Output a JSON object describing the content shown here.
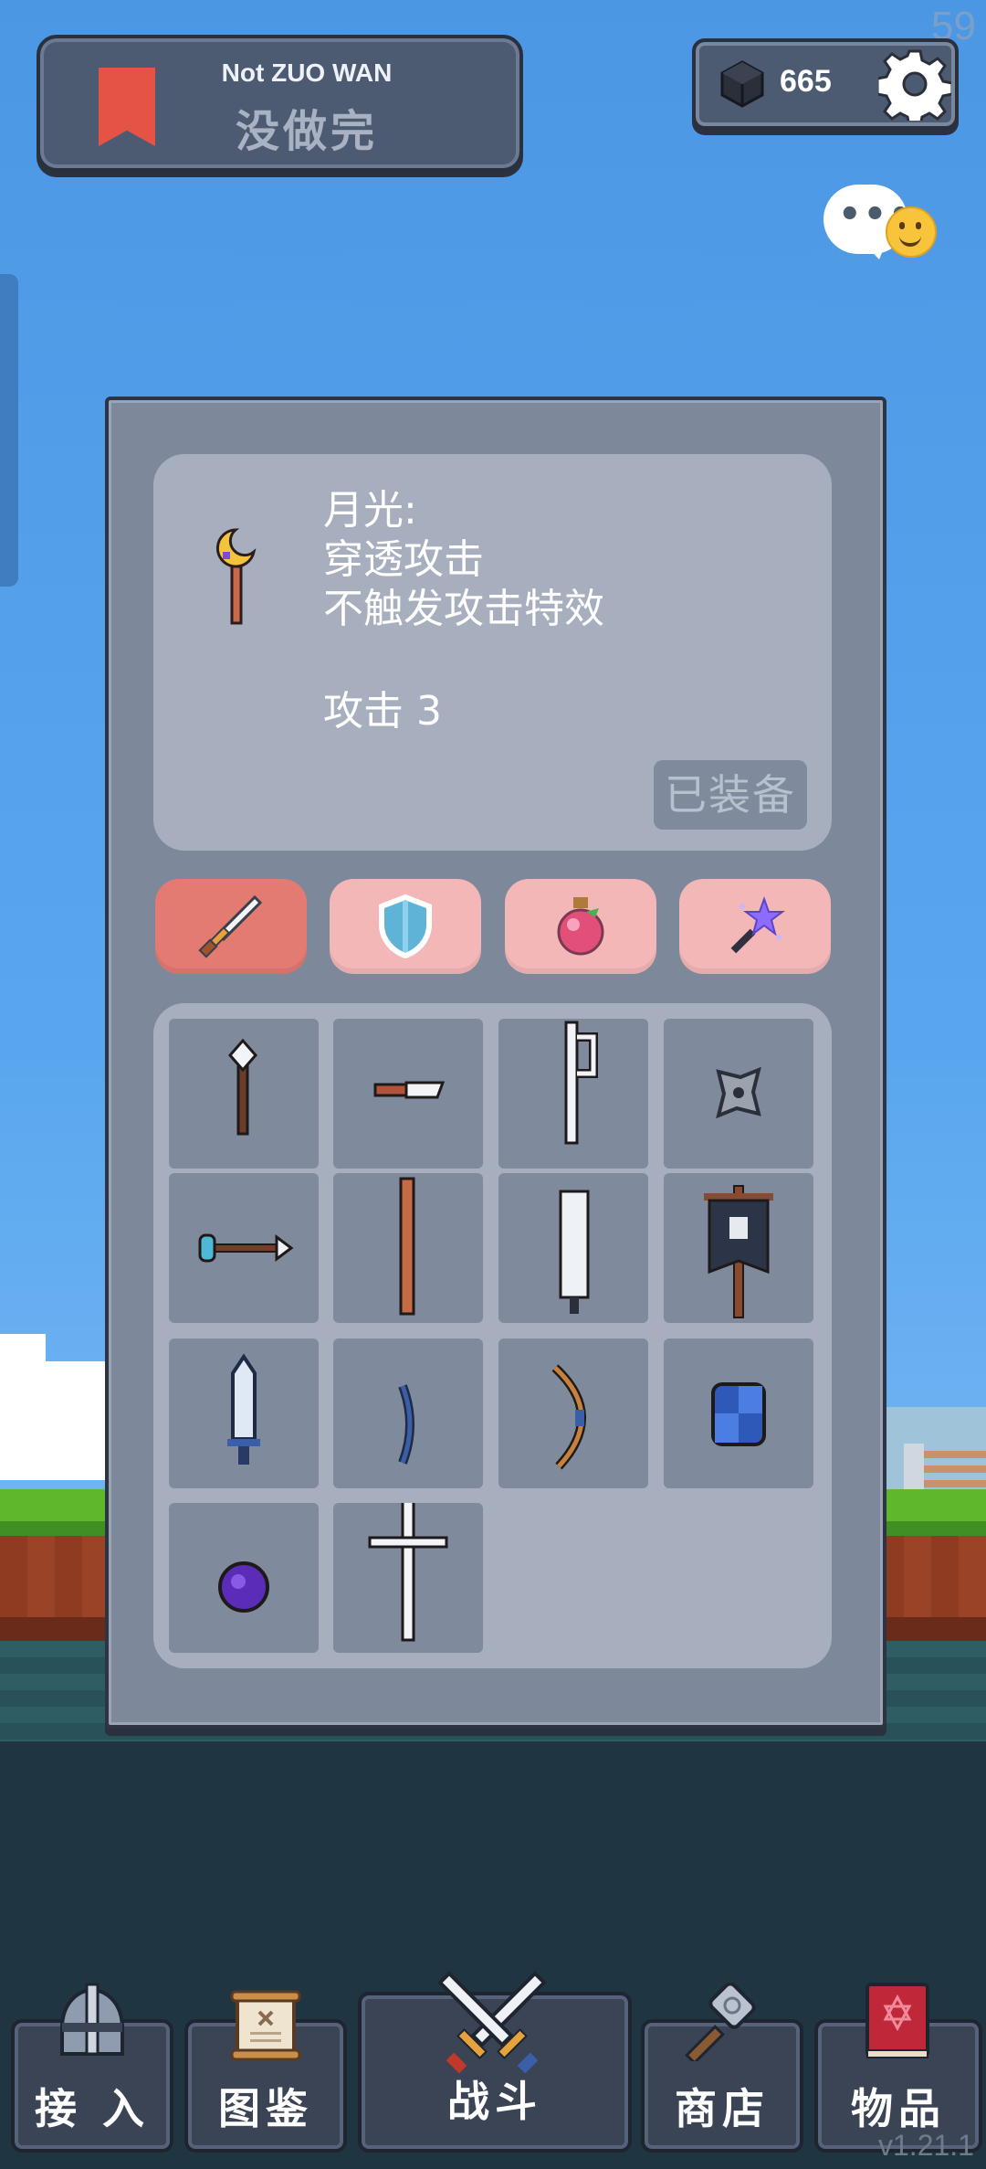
{
  "fps": "59",
  "level": {
    "title_en": "Not ZUO WAN",
    "title_zh": "没做完"
  },
  "currency": {
    "gems": "665"
  },
  "item_detail": {
    "lines": [
      "月光:",
      "穿透攻击",
      "不触发攻击特效",
      "",
      "攻击  3"
    ],
    "equip_button": "已装备"
  },
  "category_tabs": [
    {
      "name": "weapons",
      "icon": "sword-icon",
      "active": true
    },
    {
      "name": "armor",
      "icon": "shield-icon",
      "active": false
    },
    {
      "name": "potions",
      "icon": "potion-icon",
      "active": false
    },
    {
      "name": "magic",
      "icon": "magic-wand-icon",
      "active": false
    }
  ],
  "inventory_items": [
    "spear-icon",
    "knife-icon",
    "trident-icon",
    "shuriken-icon",
    "arrow-icon",
    "staff-icon",
    "greatsword-icon",
    "banner-icon",
    "crystal-sword-icon",
    "short-bow-icon",
    "long-bow-icon",
    "blue-shield-icon",
    "purple-orb-icon",
    "cross-icon"
  ],
  "nav": {
    "join": "接 入",
    "codex": "图鉴",
    "battle": "战斗",
    "shop": "商店",
    "items": "物品"
  },
  "version": "v1.21.1",
  "colors": {
    "panel": "#7d889b",
    "inner_box": "#a7afbe",
    "slot": "#7f8a9d",
    "tab_active": "#e37b72",
    "tab_inactive": "#f3b7b7",
    "bookmark": "#e45344"
  }
}
